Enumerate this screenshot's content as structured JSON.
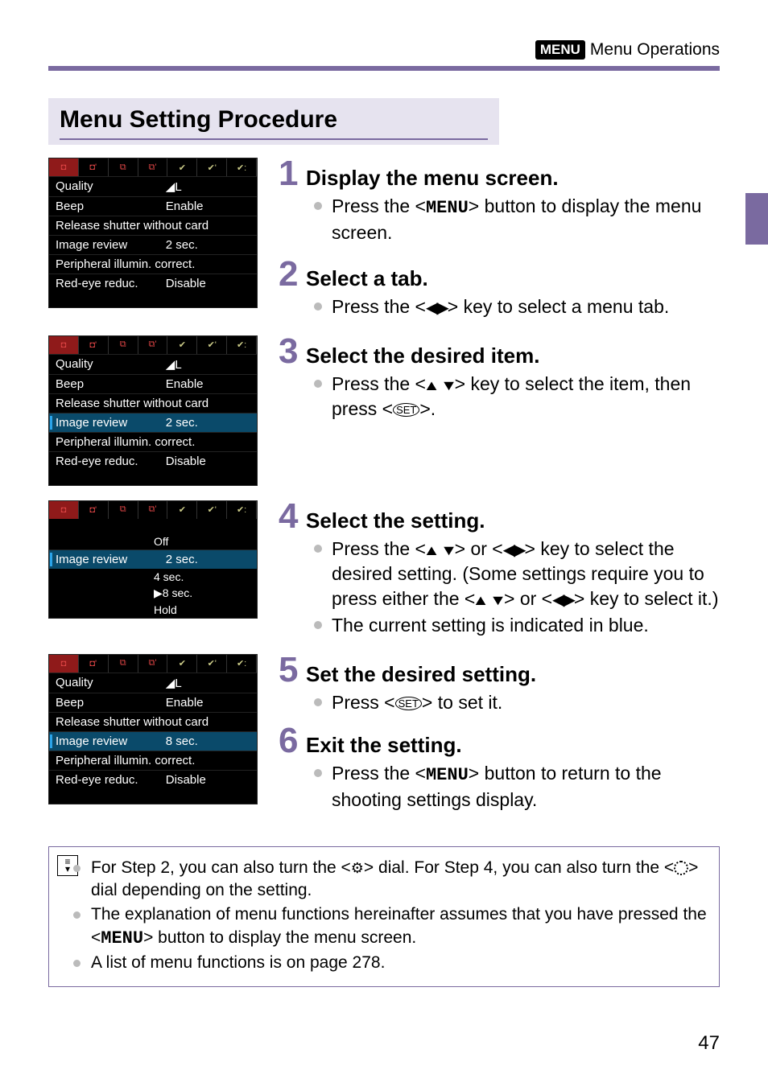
{
  "header": {
    "badge": "MENU",
    "title": "Menu Operations"
  },
  "section": {
    "heading": "Menu Setting Procedure"
  },
  "cam_common": {
    "rows": [
      {
        "l": "Quality",
        "v": "◢L"
      },
      {
        "l": "Beep",
        "v": "Enable"
      },
      {
        "l": "Release shutter without card",
        "v": ""
      },
      {
        "l": "Image review",
        "v": "2 sec."
      },
      {
        "l": "Peripheral illumin. correct.",
        "v": ""
      },
      {
        "l": "Red-eye reduc.",
        "v": "Disable"
      }
    ],
    "rows_after": [
      {
        "l": "Quality",
        "v": "◢L"
      },
      {
        "l": "Beep",
        "v": "Enable"
      },
      {
        "l": "Release shutter without card",
        "v": ""
      },
      {
        "l": "Image review",
        "v": "8 sec."
      },
      {
        "l": "Peripheral illumin. correct.",
        "v": ""
      },
      {
        "l": "Red-eye reduc.",
        "v": "Disable"
      }
    ],
    "options_label": "Image review",
    "options": [
      "Off",
      "2 sec.",
      "4 sec.",
      "8 sec.",
      "Hold"
    ]
  },
  "steps": {
    "s1": {
      "num": "1",
      "title": "Display the menu screen.",
      "b1a": "Press the <",
      "b1b": "> button to display the menu screen."
    },
    "s2": {
      "num": "2",
      "title": "Select a tab.",
      "b1a": "Press the <",
      "b1b": "> key to select a menu tab."
    },
    "s3": {
      "num": "3",
      "title": "Select the desired item.",
      "b1a": "Press the <",
      "b1b": "> key to select the item, then press <",
      "b1c": ">."
    },
    "s4": {
      "num": "4",
      "title": "Select the setting.",
      "b1a": "Press the <",
      "b1b": "> or <",
      "b1c": "> key to select the desired setting. (Some settings require you to press either the <",
      "b1d": "> or <",
      "b1e": "> key to select it.)",
      "b2": "The current setting is indicated in blue."
    },
    "s5": {
      "num": "5",
      "title": "Set the desired setting.",
      "b1a": "Press <",
      "b1b": "> to set it."
    },
    "s6": {
      "num": "6",
      "title": "Exit the setting.",
      "b1a": "Press the <",
      "b1b": "> button to return to the shooting settings display."
    }
  },
  "notes": {
    "n1a": "For Step 2, you can also turn the <",
    "n1b": "> dial. For Step 4, you can also turn the <",
    "n1c": "> dial depending on the setting.",
    "n2a": "The explanation of menu functions hereinafter assumes that you have pressed the <",
    "n2b": "> button to display the menu screen.",
    "n3": "A list of menu functions is on page 278."
  },
  "page_number": "47"
}
